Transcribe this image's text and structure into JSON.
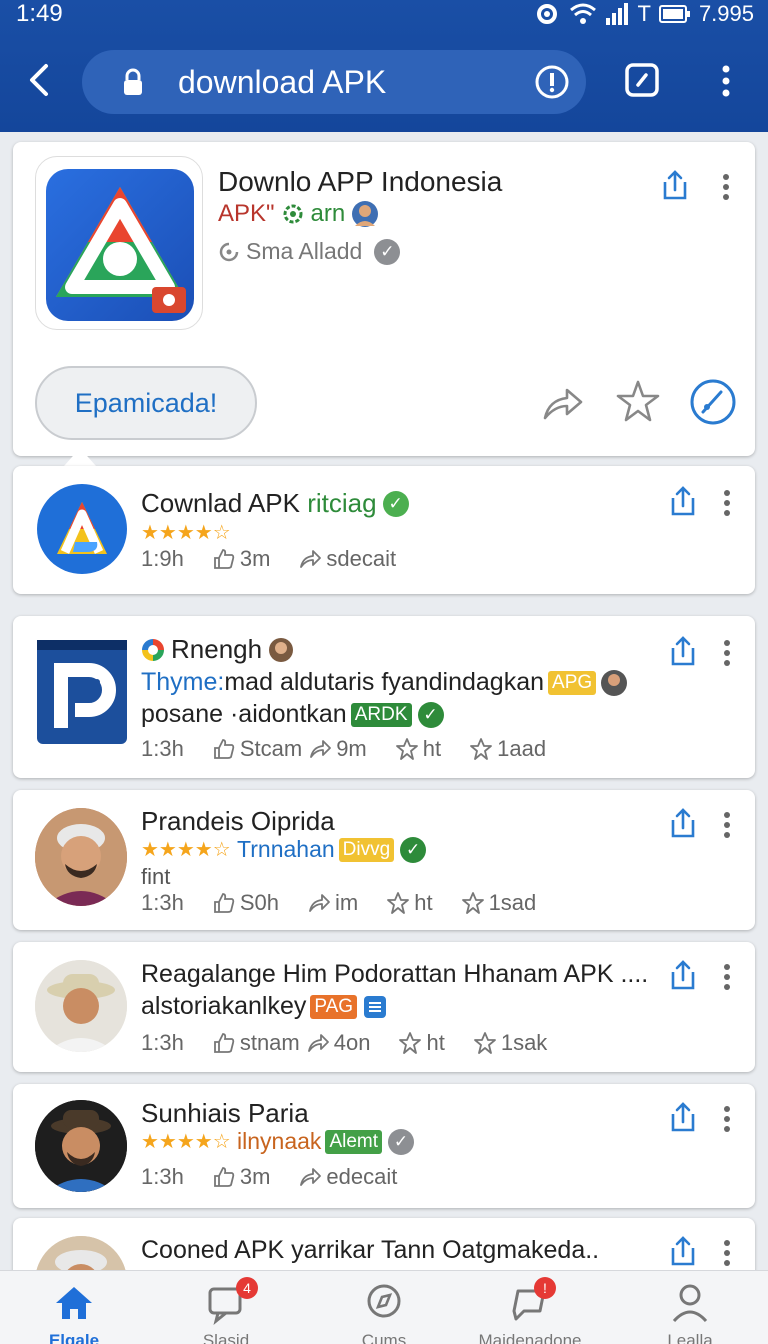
{
  "status": {
    "time": "1:49",
    "signal_text": "T",
    "battery_text": "7.995"
  },
  "browser": {
    "url_text": "download APK"
  },
  "featured": {
    "title": "Downlo APP Indonesia",
    "sub_prefix": "APK\"",
    "sub_suffix": "arn",
    "developer": "Sma Alladd",
    "expand_label": "Epamicada!"
  },
  "items": [
    {
      "title": "Cownlad APK",
      "title_accent": "ritciag",
      "stars": "★★★★☆",
      "time": "1:9h",
      "likes": "3m",
      "shares": "sdecait"
    },
    {
      "title": "Rnengh",
      "line2_accent": "Thyme:",
      "line2": "mad aldutaris fyandindagkan",
      "tag1": "APG",
      "line3": "posane ·aidontkan",
      "tag2": "ARDK",
      "time": "1:3h",
      "likes": "Stcam",
      "shares": "9m",
      "saves": "ht",
      "rating": "1aad"
    },
    {
      "title": "Prandeis Oiprida",
      "stars": "★★★★☆",
      "accent": "Trnnahan",
      "tag": "Divvg",
      "extra": "fint",
      "time": "1:3h",
      "likes": "S0h",
      "shares": "im",
      "saves": "ht",
      "rating": "1sad"
    },
    {
      "title": "Reagalange Him Podorattan Hhanam APK ....",
      "line2": "alstoriakanlkey",
      "tag": "PAG",
      "time": "1:3h",
      "likes": "stnam",
      "shares": "4on",
      "saves": "ht",
      "rating": "1sak"
    },
    {
      "title": "Sunhiais Paria",
      "stars": "★★★★☆",
      "accent": "ilnynaak",
      "tag": "Alemt",
      "time": "1:3h",
      "likes": "3m",
      "shares": "edecait"
    },
    {
      "title": "Cooned APK yarrikar Tann Oatgmakeda.."
    }
  ],
  "nav": [
    {
      "label": "Elgale",
      "badge": ""
    },
    {
      "label": "Slasid",
      "badge": "4"
    },
    {
      "label": "Cums",
      "badge": ""
    },
    {
      "label": "Maidenadone",
      "badge": "!"
    },
    {
      "label": "Lealla",
      "badge": ""
    }
  ],
  "colors": {
    "brand": "#14469b",
    "accent_blue": "#1f6fc4",
    "green": "#2e8b3a",
    "star": "#f5a51c"
  }
}
